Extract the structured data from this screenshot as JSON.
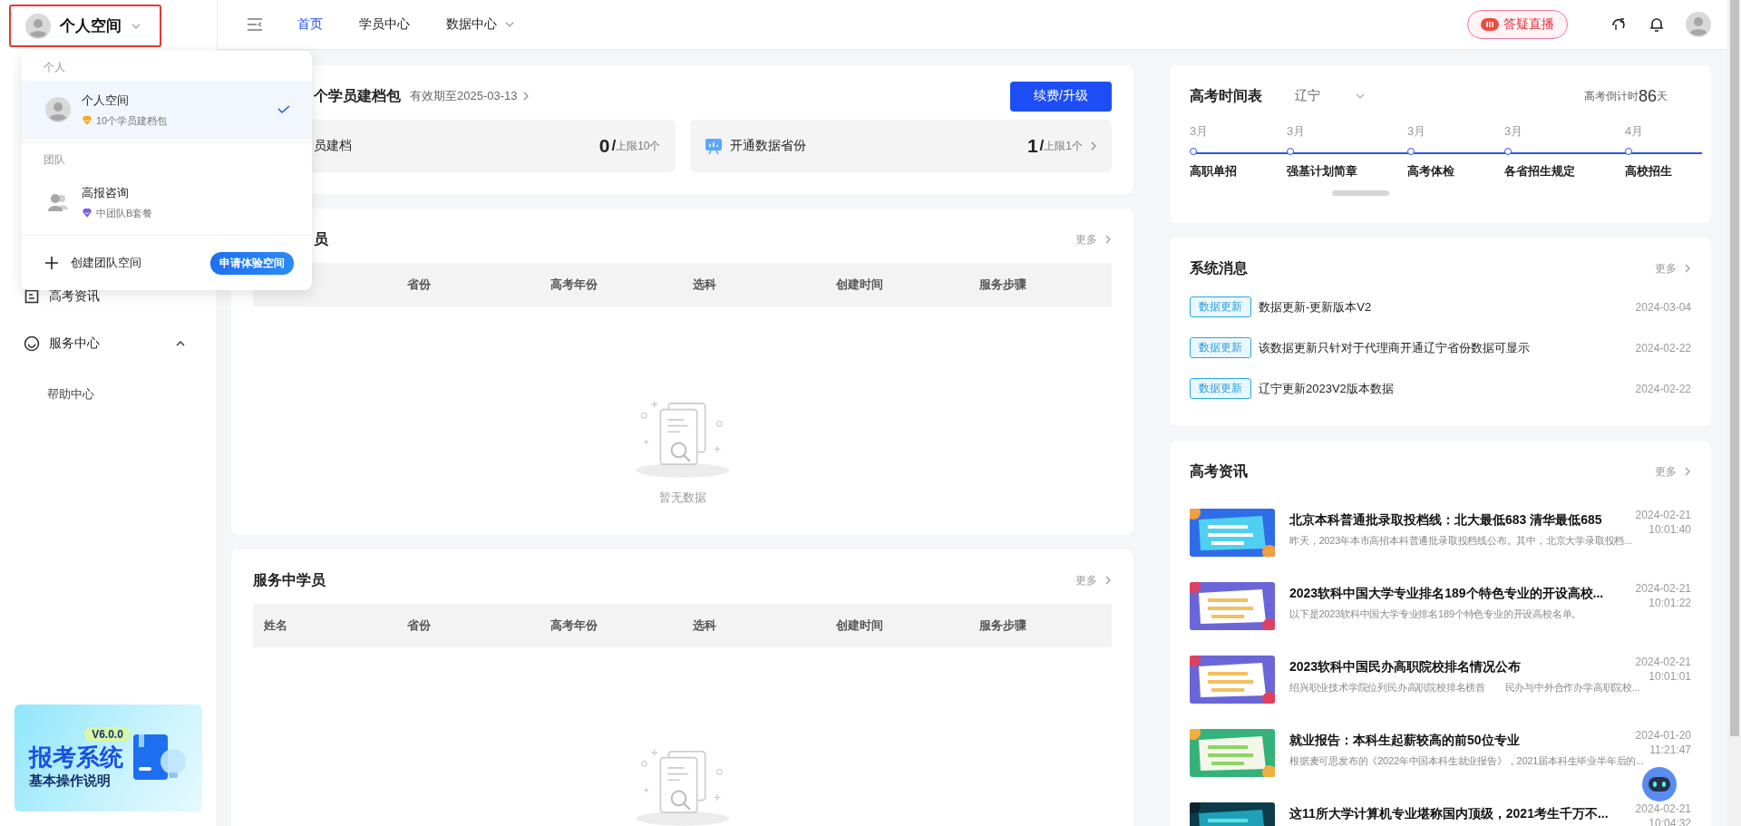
{
  "workspace_switcher": {
    "label": "个人空间"
  },
  "workspace_menu": {
    "groups": [
      {
        "heading": "个人",
        "items": [
          {
            "name": "个人空间",
            "plan": "10个学员建档包",
            "kind": "personal",
            "selected": true
          }
        ]
      },
      {
        "heading": "团队",
        "items": [
          {
            "name": "高报咨询",
            "plan": "中团队B套餐",
            "kind": "team",
            "selected": false
          }
        ]
      }
    ],
    "create_label": "创建团队空间",
    "apply_button": "申请体验空间"
  },
  "sidebar": {
    "items": [
      {
        "label": "高考资讯",
        "kind": "page"
      },
      {
        "label": "服务中心",
        "kind": "group",
        "expanded": true,
        "children": [
          {
            "label": "帮助中心"
          }
        ]
      }
    ]
  },
  "banner": {
    "version": "V6.0.0",
    "title": "报考系统",
    "subtitle": "基本操作说明"
  },
  "top_nav": {
    "tabs": [
      {
        "label": "首页",
        "selected": true,
        "kind": "link"
      },
      {
        "label": "学员中心",
        "selected": false,
        "kind": "link"
      },
      {
        "label": "数据中心",
        "selected": false,
        "kind": "menu"
      }
    ],
    "live_button": "答疑直播"
  },
  "package_card": {
    "title": "个学员建档包",
    "validity": "有效期至2025-03-13",
    "button": "续费/升级",
    "stats": [
      {
        "label": "员建档",
        "value": "0",
        "separator": "/",
        "limit": "上限10个",
        "kind": "partial"
      },
      {
        "label": "开通数据省份",
        "value": "1",
        "separator": "/",
        "limit": "上限1个",
        "kind": "link"
      }
    ]
  },
  "sections": [
    {
      "title": "员",
      "more": "更多",
      "columns": [
        "省份",
        "高考年份",
        "选科",
        "创建时间",
        "服务步骤"
      ],
      "empty_text": "暂无数据"
    },
    {
      "title": "服务中学员",
      "more": "更多",
      "columns": [
        "姓名",
        "省份",
        "高考年份",
        "选科",
        "创建时间",
        "服务步骤"
      ]
    }
  ],
  "timetable": {
    "title": "高考时间表",
    "region": "辽宁",
    "countdown_label": "高考倒计时",
    "countdown_value": "86",
    "countdown_unit": "天",
    "events": [
      {
        "month": "3月",
        "label": "高职单招"
      },
      {
        "month": "3月",
        "label": "强基计划简章"
      },
      {
        "month": "3月",
        "label": "高考体检"
      },
      {
        "month": "3月",
        "label": "各省招生规定"
      },
      {
        "month": "4月",
        "label": "高校招生"
      }
    ]
  },
  "messages": {
    "title": "系统消息",
    "more": "更多",
    "items": [
      {
        "tag": "数据更新",
        "text": "数据更新-更新版本V2",
        "date": "2024-03-04"
      },
      {
        "tag": "数据更新",
        "text": "该数据更新只针对于代理商开通辽宁省份数据可显示",
        "date": "2024-02-22"
      },
      {
        "tag": "数据更新",
        "text": "辽宁更新2023V2版本数据",
        "date": "2024-02-22"
      }
    ]
  },
  "news": {
    "title": "高考资讯",
    "more": "更多",
    "items": [
      {
        "title": "北京本科普通批录取投档线：北大最低683 清华最低685",
        "summary": "昨天，2023年本市高招本科普通批录取投档线公布。其中，北京大学录取投档...",
        "date": "2024-02-21",
        "time": "10:01:40"
      },
      {
        "title": "2023软科中国大学专业排名189个特色专业的开设高校...",
        "summary": "以下是2023软科中国大学专业排名189个特色专业的开设高校名单。",
        "date": "2024-02-21",
        "time": "10:01:22"
      },
      {
        "title": "2023软科中国民办高职院校排名情况公布",
        "summary": "绍兴职业技术学院位列民办高职院校排名榜首　　民办与中外合作办学高职院校...",
        "date": "2024-02-21",
        "time": "10:01:01"
      },
      {
        "title": "就业报告：本科生起薪较高的前50位专业",
        "summary": "根据麦可思发布的《2022年中国本科生就业报告》，2021届本科生毕业半年后的...",
        "date": "2024-01-20",
        "time": "11:21:47"
      },
      {
        "title": "这11所大学计算机专业堪称国内顶级，2021考生千万不...",
        "date": "2024-02-21",
        "time": "10:04:32"
      }
    ]
  }
}
